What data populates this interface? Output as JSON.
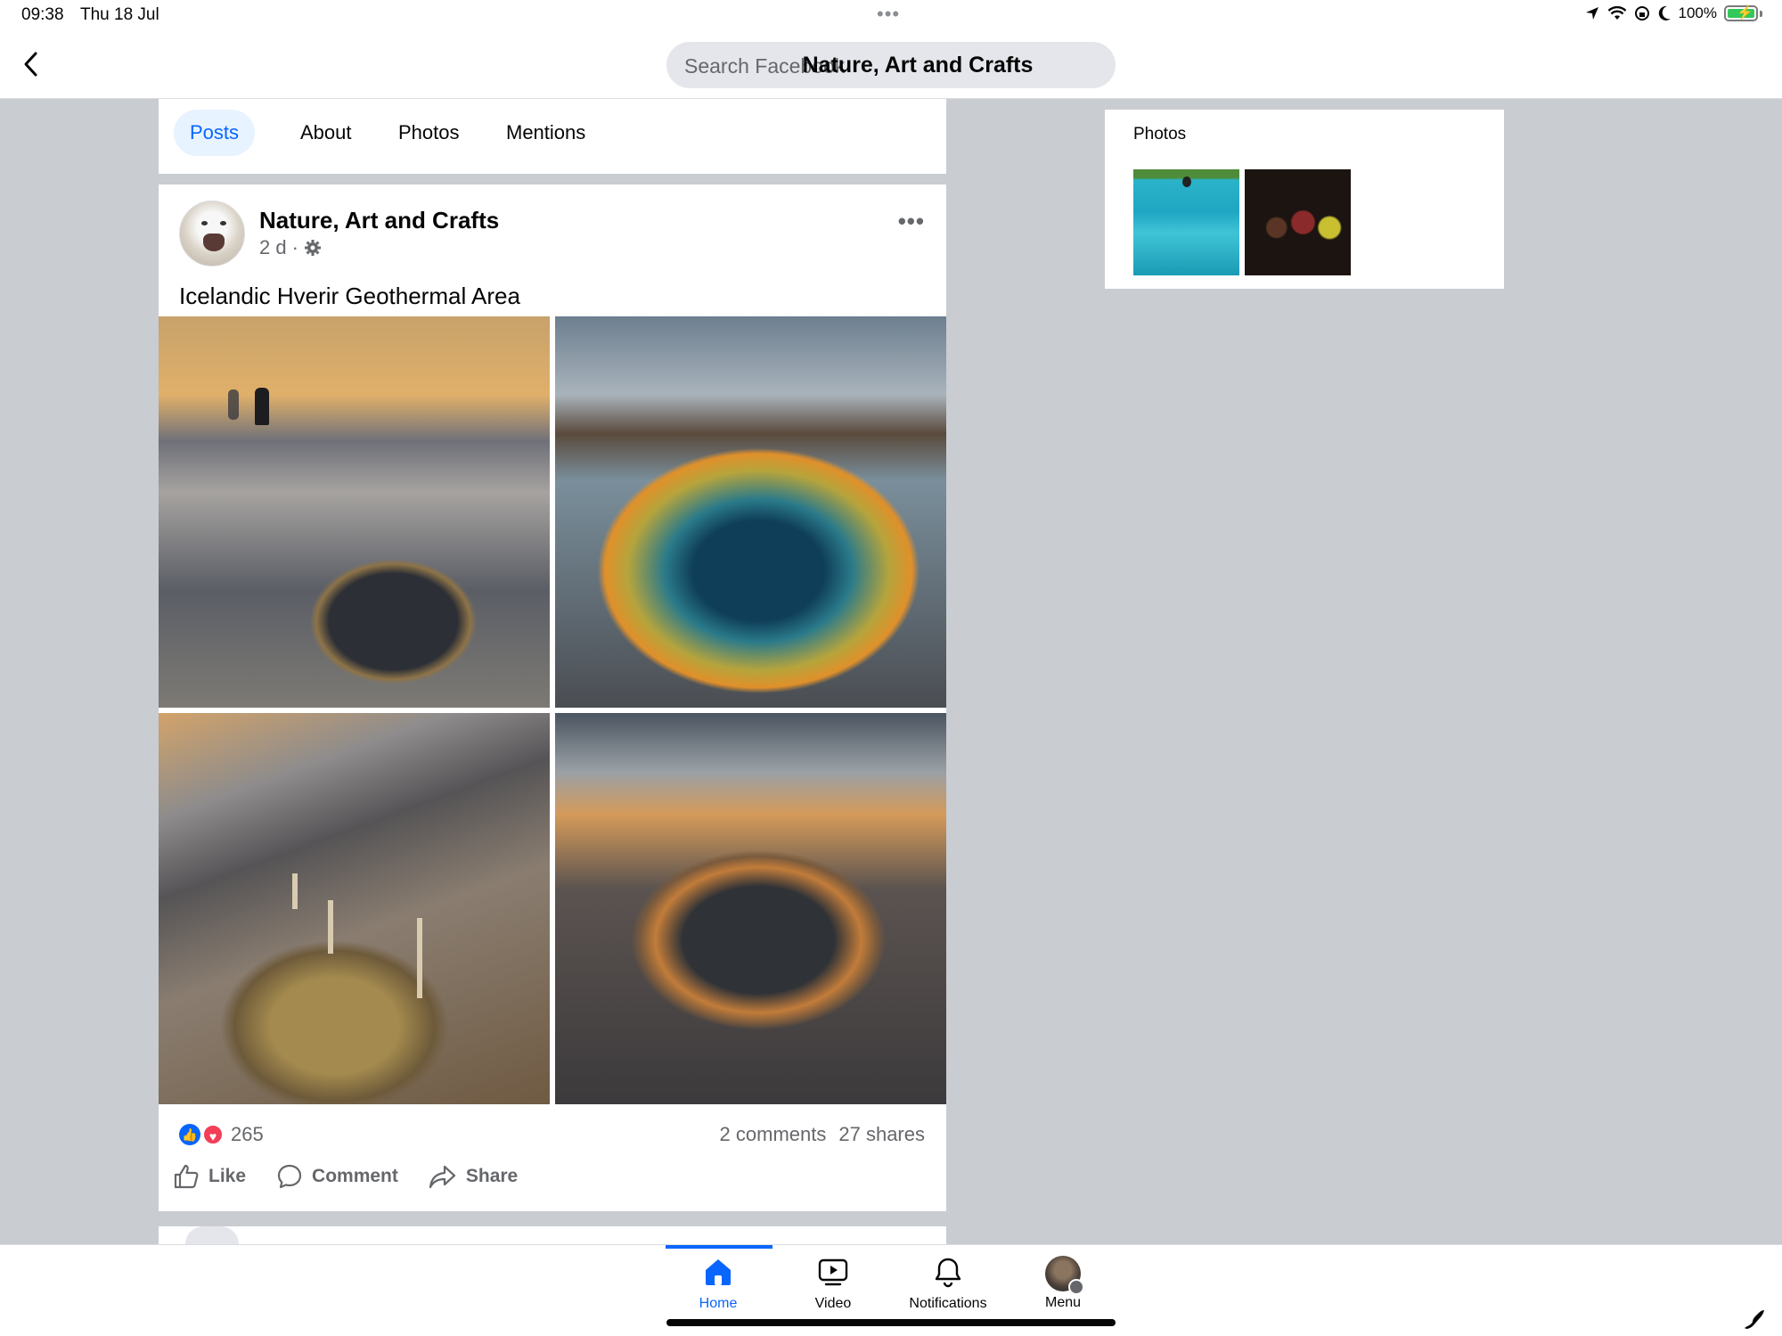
{
  "status_bar": {
    "time": "09:38",
    "date": "Thu 18 Jul",
    "battery": "100%",
    "icons": [
      "location-arrow-icon",
      "wifi-icon",
      "screen-lock-icon",
      "moon-icon",
      "battery-charging-icon"
    ]
  },
  "top_nav": {
    "search_placeholder": "Search Facebook",
    "page_title": "Nature, Art and Crafts"
  },
  "tabs": [
    {
      "label": "Posts",
      "active": true
    },
    {
      "label": "About",
      "active": false
    },
    {
      "label": "Photos",
      "active": false
    },
    {
      "label": "Mentions",
      "active": false
    }
  ],
  "post": {
    "author": "Nature, Art and Crafts",
    "time": "2 d",
    "separator": "·",
    "text": "Icelandic Hverir Geothermal Area",
    "reactions_count": "265",
    "comments": "2 comments",
    "shares": "27 shares",
    "actions": {
      "like": "Like",
      "comment": "Comment",
      "share": "Share"
    }
  },
  "photos_card": {
    "title": "Photos"
  },
  "tab_bar": {
    "home": "Home",
    "video": "Video",
    "notifications": "Notifications",
    "menu": "Menu",
    "active": "Home"
  },
  "colors": {
    "accent": "#0866ff",
    "background": "#c9ccd1",
    "secondary_text": "#65676b",
    "love": "#f33e58"
  }
}
